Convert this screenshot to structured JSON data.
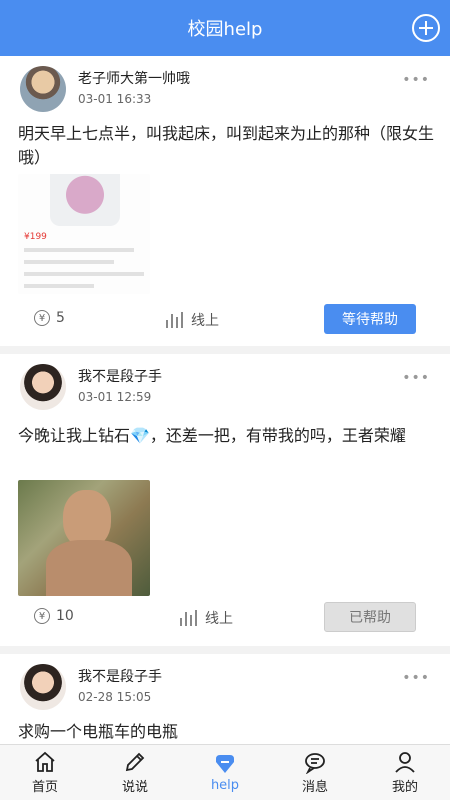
{
  "header": {
    "title": "校园help",
    "add_icon": "plus-circle-icon"
  },
  "posts": [
    {
      "name": "老子师大第一帅哦",
      "time": "03-01  16:33",
      "content": "明天早上七点半，叫我起床，叫到起来为止的那种（限女生哦）",
      "image_price": "¥199",
      "reward": "5",
      "online": "线上",
      "status": "等待帮助",
      "status_color": "#4a8df0"
    },
    {
      "name": "我不是段子手",
      "time": "03-01  12:59",
      "content": "今晚让我上钻石💎，还差一把，有带我的吗，王者荣耀",
      "reward": "10",
      "online": "线上",
      "status": "已帮助",
      "status_color": "#e0e0e0"
    },
    {
      "name": "我不是段子手",
      "time": "02-28  15:05",
      "content": "求购一个电瓶车的电瓶"
    }
  ],
  "more_icon": "•••",
  "tabs": [
    {
      "label": "首页",
      "icon": "home-icon"
    },
    {
      "label": "说说",
      "icon": "pencil-icon"
    },
    {
      "label": "help",
      "icon": "help-icon",
      "active": true
    },
    {
      "label": "消息",
      "icon": "message-icon"
    },
    {
      "label": "我的",
      "icon": "profile-icon"
    }
  ],
  "accent_color": "#4a8df0"
}
